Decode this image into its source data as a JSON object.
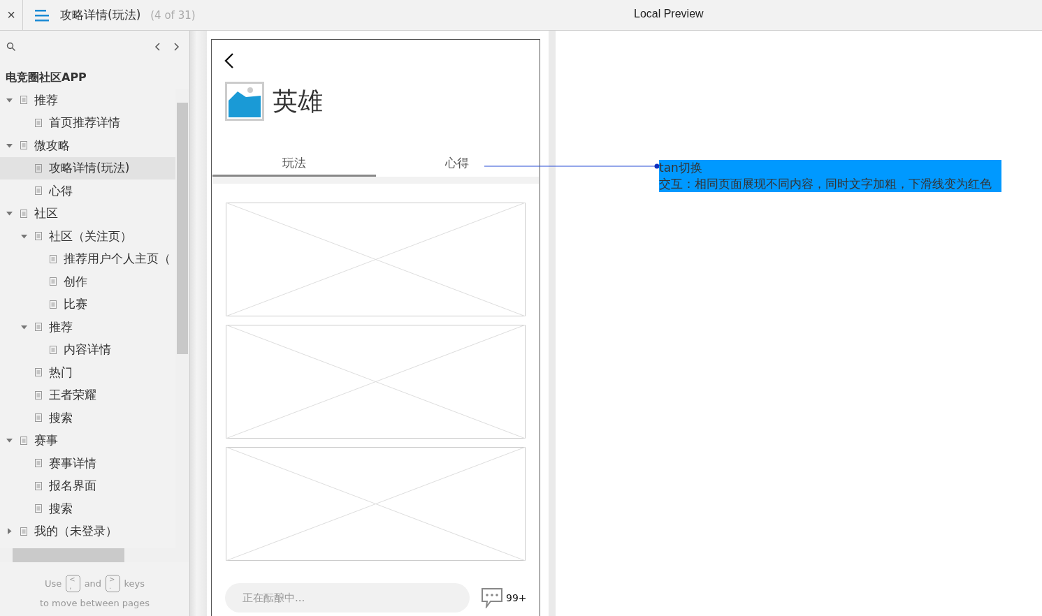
{
  "topbar": {
    "close": "×",
    "page_title": "攻略详情(玩法)",
    "page_count": "(4 of 31)",
    "preview_title": "Local Preview"
  },
  "sidebar": {
    "project": "电竞圈社区APP",
    "tree": [
      {
        "label": "推荐",
        "expanded": true,
        "selected": false,
        "children": [
          {
            "label": "首页推荐详情",
            "selected": false
          }
        ]
      },
      {
        "label": "微攻略",
        "expanded": true,
        "selected": false,
        "children": [
          {
            "label": "攻略详情(玩法)",
            "selected": true
          },
          {
            "label": "心得",
            "selected": false
          }
        ]
      },
      {
        "label": "社区",
        "expanded": true,
        "selected": false,
        "children": [
          {
            "label": "社区（关注页）",
            "expanded": true,
            "selected": false,
            "children": [
              {
                "label": "推荐用户个人主页（",
                "selected": false
              },
              {
                "label": "创作",
                "selected": false
              },
              {
                "label": "比赛",
                "selected": false
              }
            ]
          },
          {
            "label": "推荐",
            "expanded": true,
            "selected": false,
            "children": [
              {
                "label": "内容详情",
                "selected": false
              }
            ]
          },
          {
            "label": "热门",
            "selected": false
          },
          {
            "label": "王者荣耀",
            "selected": false
          },
          {
            "label": "搜索",
            "selected": false
          }
        ]
      },
      {
        "label": "赛事",
        "expanded": true,
        "selected": false,
        "children": [
          {
            "label": "赛事详情",
            "selected": false
          },
          {
            "label": "报名界面",
            "selected": false
          },
          {
            "label": "搜索",
            "selected": false
          }
        ]
      },
      {
        "label": "我的（未登录）",
        "expanded": false,
        "selected": false
      }
    ],
    "hint": {
      "use": "Use",
      "key1_top": "<",
      "key1_bottom": ",",
      "and": "and",
      "key2_top": ">",
      "key2_bottom": ".",
      "keys": "keys",
      "line2": "to move between pages"
    }
  },
  "phone": {
    "title": "英雄",
    "tabs": [
      {
        "label": "玩法",
        "selected": true
      },
      {
        "label": "心得",
        "selected": false
      }
    ],
    "input": {
      "placeholder": "正在酝酿中..."
    },
    "comment_count": "99+"
  },
  "annotation": {
    "title": "tan切换",
    "text": "交互：相同页面展现不同内容，同时文字加粗，下滑线变为红色"
  }
}
